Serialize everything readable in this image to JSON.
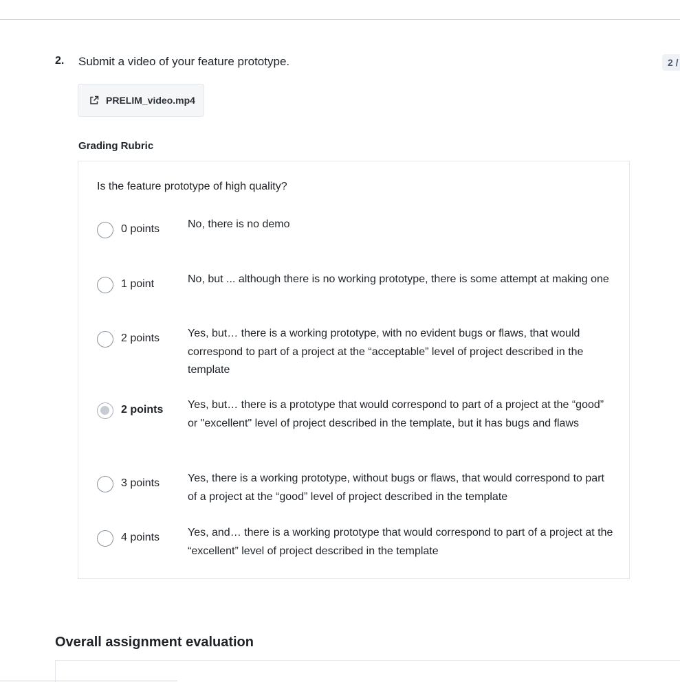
{
  "question": {
    "number": "2.",
    "text": "Submit a video of your feature prototype.",
    "score_badge": "2 /"
  },
  "attachment": {
    "icon": "external-link-icon",
    "filename": "PRELIM_video.mp4"
  },
  "rubric": {
    "heading": "Grading Rubric",
    "question": "Is the feature prototype of high quality?",
    "options": [
      {
        "points": "0 points",
        "description": "No, there is no demo",
        "selected": false
      },
      {
        "points": "1 point",
        "description": "No, but ... although there is no working prototype, there is some attempt at making one",
        "selected": false
      },
      {
        "points": "2 points",
        "description": "Yes, but… there is a working prototype, with no evident bugs or flaws, that would correspond to part of a project at the “acceptable” level of project described in the template",
        "selected": false
      },
      {
        "points": "2 points",
        "description": "Yes, but… there is a  prototype that would correspond to part of a project at the “good” or \"excellent\" level of project described in the template, but it has bugs and flaws",
        "selected": true
      },
      {
        "points": "3 points",
        "description": "Yes, there is a working prototype, without bugs or flaws, that would correspond to part of a project at the “good” level of project described in the template",
        "selected": false
      },
      {
        "points": "4 points",
        "description": "Yes, and… there is a working prototype that would correspond to part of a project at the “excellent” level of project described in the template",
        "selected": false
      }
    ]
  },
  "overall": {
    "heading": "Overall assignment evaluation"
  }
}
